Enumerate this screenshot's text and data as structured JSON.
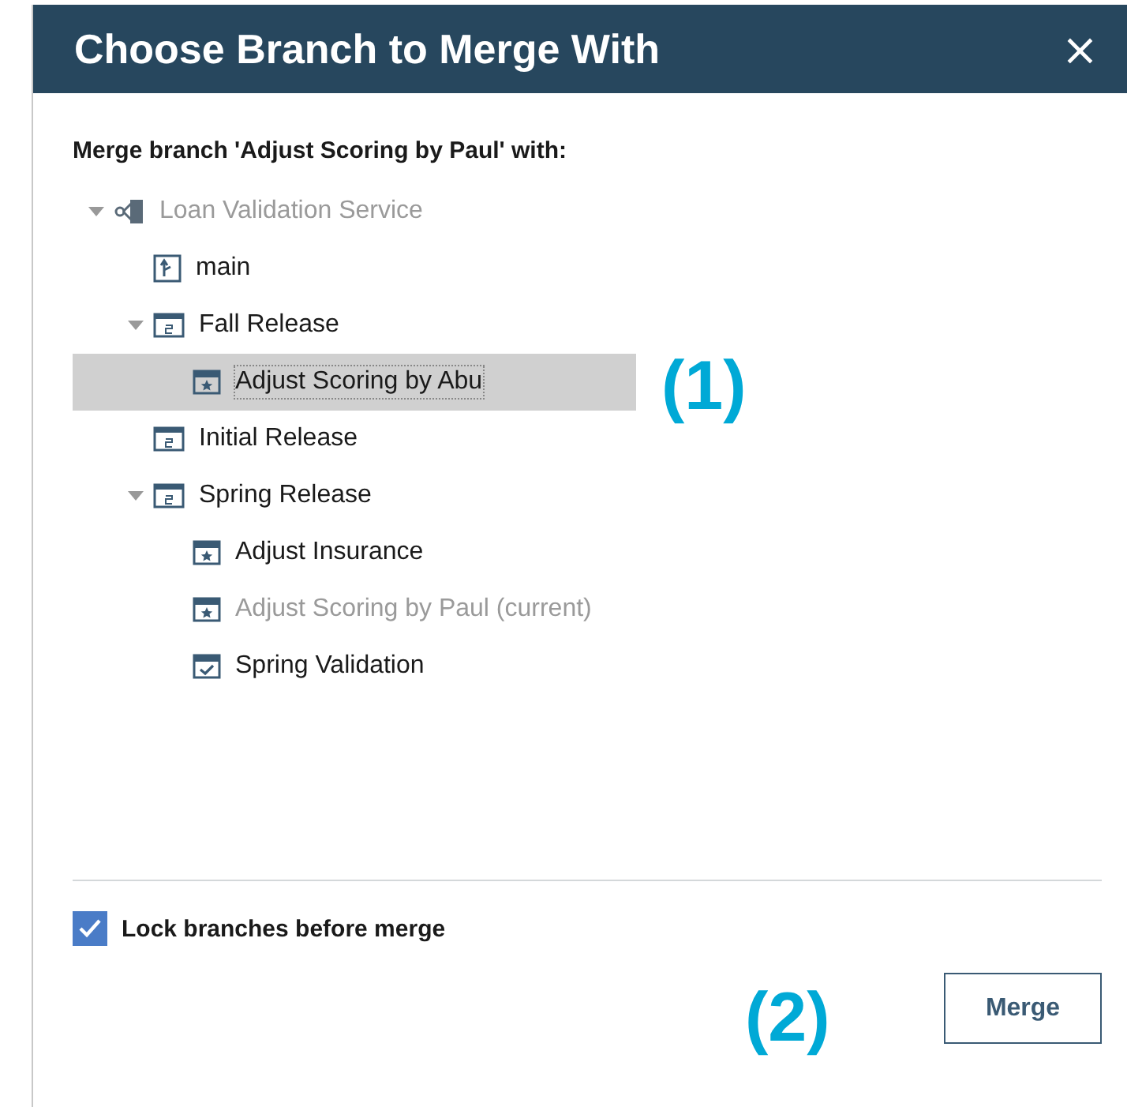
{
  "dialog": {
    "title": "Choose Branch to Merge With",
    "close": "×"
  },
  "prompt": "Merge branch 'Adjust Scoring by Paul' with:",
  "tree": [
    {
      "label": "Loan Validation Service",
      "kind": "service",
      "expanded": true,
      "disabled": true,
      "selected": false,
      "children": [
        {
          "label": "main",
          "kind": "main",
          "disabled": false,
          "selected": false
        },
        {
          "label": "Fall Release",
          "kind": "release",
          "expanded": true,
          "disabled": false,
          "selected": false,
          "children": [
            {
              "label": "Adjust Scoring by Abu",
              "kind": "branch",
              "disabled": false,
              "selected": true
            }
          ]
        },
        {
          "label": "Initial Release",
          "kind": "release",
          "disabled": false,
          "selected": false
        },
        {
          "label": "Spring Release",
          "kind": "release",
          "expanded": true,
          "disabled": false,
          "selected": false,
          "children": [
            {
              "label": "Adjust Insurance",
              "kind": "branch",
              "disabled": false,
              "selected": false
            },
            {
              "label": "Adjust Scoring by Paul (current)",
              "kind": "branch",
              "disabled": true,
              "selected": false
            },
            {
              "label": "Spring Validation",
              "kind": "validation",
              "disabled": false,
              "selected": false
            }
          ]
        }
      ]
    }
  ],
  "lock_option": {
    "label": "Lock branches before merge",
    "checked": true
  },
  "buttons": [
    "Merge"
  ],
  "callouts": [
    "(1)",
    "(2)"
  ]
}
